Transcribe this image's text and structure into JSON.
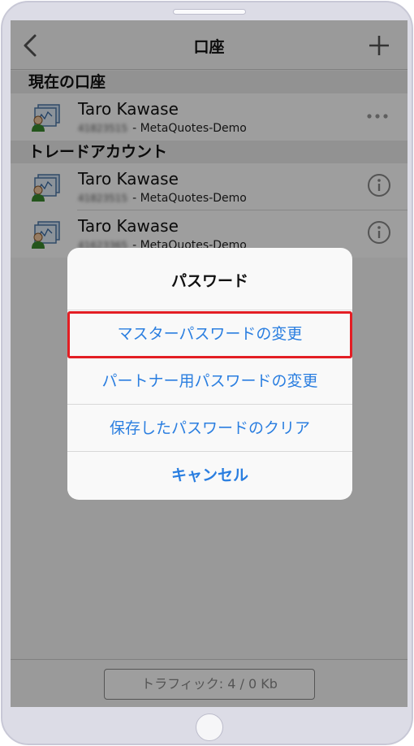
{
  "nav": {
    "title": "口座",
    "back_icon": "chevron-left-icon",
    "add_icon": "plus-icon"
  },
  "sections": {
    "current": "現在の口座",
    "trade": "トレードアカウント"
  },
  "current_account": {
    "name": "Taro Kawase",
    "number_blurred": "41823515",
    "server": "- MetaQuotes-Demo"
  },
  "trade_accounts": [
    {
      "name": "Taro Kawase",
      "number_blurred": "41823515",
      "server": "- MetaQuotes-Demo"
    },
    {
      "name": "Taro Kawase",
      "number_blurred": "41623365",
      "server": "- MetaQuotes-Demo"
    }
  ],
  "footer": {
    "traffic": "トラフィック: 4 / 0 Kb"
  },
  "action_sheet": {
    "title": "パスワード",
    "options": [
      "マスターパスワードの変更",
      "パートナー用パスワードの変更",
      "保存したパスワードのクリア"
    ],
    "cancel": "キャンセル"
  },
  "colors": {
    "accent": "#2a7ee0",
    "highlight": "#e31e24"
  }
}
